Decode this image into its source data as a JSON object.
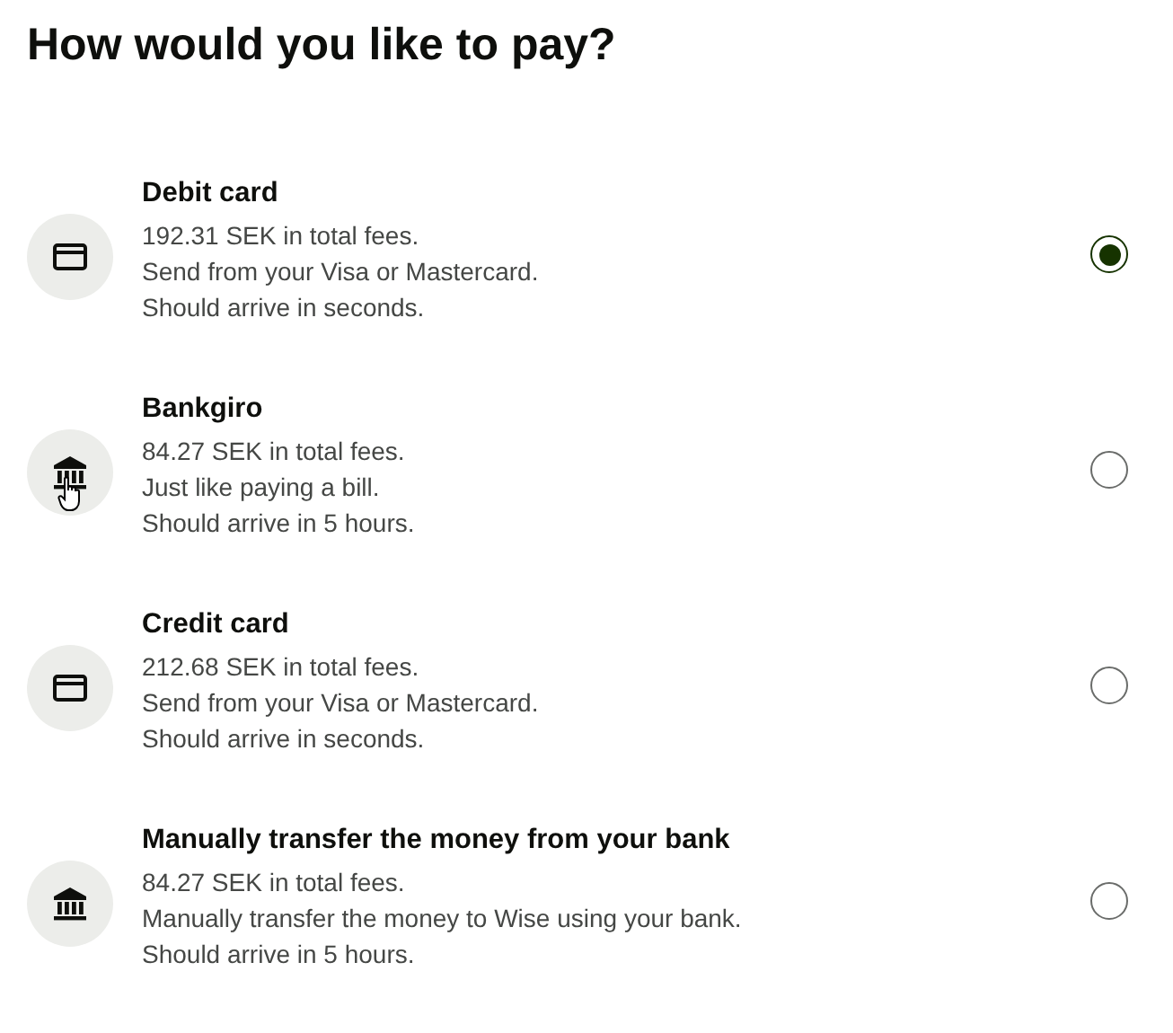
{
  "title": "How would you like to pay?",
  "options": [
    {
      "kind": "card",
      "title": "Debit card",
      "lines": [
        "192.31 SEK in total fees.",
        "Send from your Visa or Mastercard.",
        "Should arrive in seconds."
      ],
      "selected": true,
      "hovered": false
    },
    {
      "kind": "bank",
      "title": "Bankgiro",
      "lines": [
        "84.27 SEK in total fees.",
        "Just like paying a bill.",
        "Should arrive in 5 hours."
      ],
      "selected": false,
      "hovered": true
    },
    {
      "kind": "card",
      "title": "Credit card",
      "lines": [
        "212.68 SEK in total fees.",
        "Send from your Visa or Mastercard.",
        "Should arrive in seconds."
      ],
      "selected": false,
      "hovered": false
    },
    {
      "kind": "bank",
      "title": "Manually transfer the money from your bank",
      "lines": [
        "84.27 SEK in total fees.",
        "Manually transfer the money to Wise using your bank.",
        "Should arrive in 5 hours."
      ],
      "selected": false,
      "hovered": false
    }
  ]
}
